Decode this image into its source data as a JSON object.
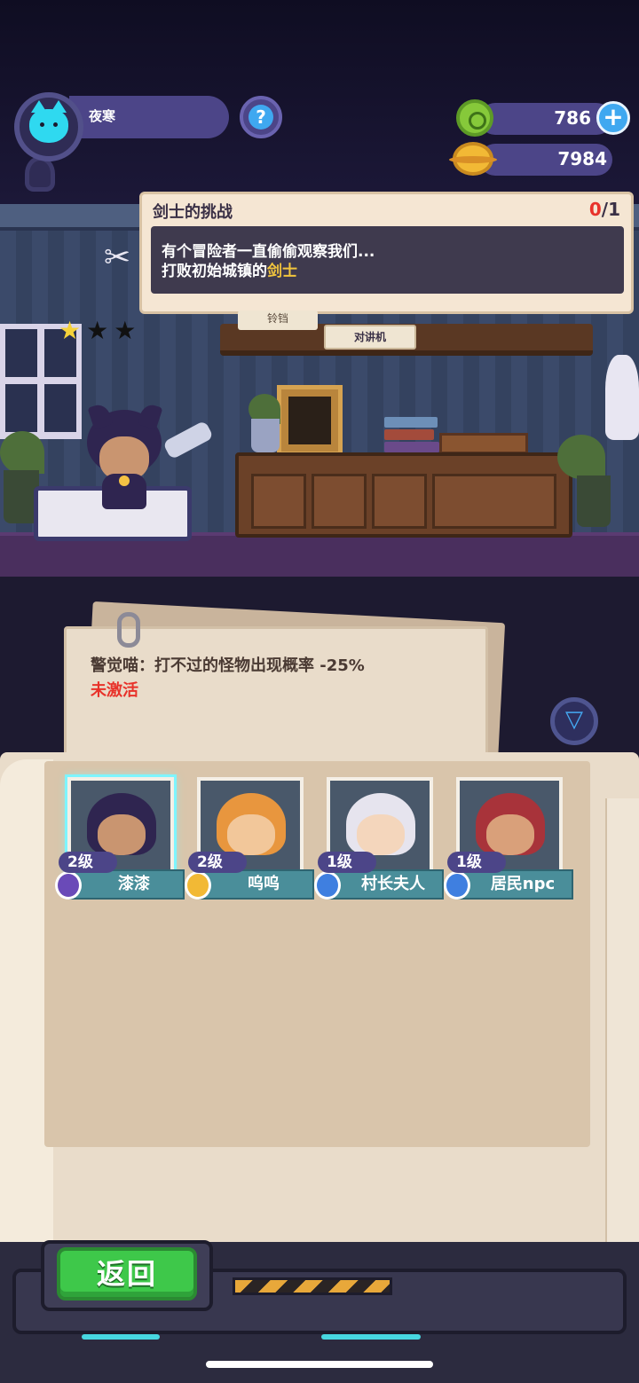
{
  "player": {
    "name": "夜寒"
  },
  "hud": {
    "help_label": "?",
    "add_label": "+"
  },
  "currencies": [
    {
      "name": "gem",
      "value": "786",
      "icon": "green-gem-icon"
    },
    {
      "name": "coin",
      "value": "7984",
      "icon": "gold-coin-icon"
    }
  ],
  "quest": {
    "title": "剑士的挑战",
    "progress_current": "0",
    "progress_sep": "/",
    "progress_total": "1",
    "line1": "有个冒险者一直偷偷观察我们...",
    "line2_prefix": "打败初始城镇的",
    "line2_highlight": "剑士"
  },
  "scene": {
    "stars_filled": 1,
    "stars_total": 3,
    "sign_left": "铃铛",
    "sign_right": "对讲机"
  },
  "note": {
    "effect": "警觉喵：打不过的怪物出现概率 -25%",
    "status": "未激活"
  },
  "characters": [
    {
      "level": "2级",
      "name": "漆漆",
      "badge": "purple-claw-badge-icon",
      "selected": true
    },
    {
      "level": "2级",
      "name": "呜呜",
      "badge": "gold-shield-badge-icon",
      "selected": false
    },
    {
      "level": "1级",
      "name": "村长夫人",
      "badge": "blue-claw-badge-icon",
      "selected": false
    },
    {
      "level": "1级",
      "name": "居民npc",
      "badge": "blue-shield-badge-icon",
      "selected": false
    }
  ],
  "book_footer": "",
  "back_button": {
    "label": "返回"
  },
  "colors": {
    "accent_red": "#e8322a",
    "highlight_yellow": "#f2c53d",
    "back_green": "#3ec84a",
    "hud_purple": "#4c4588"
  }
}
